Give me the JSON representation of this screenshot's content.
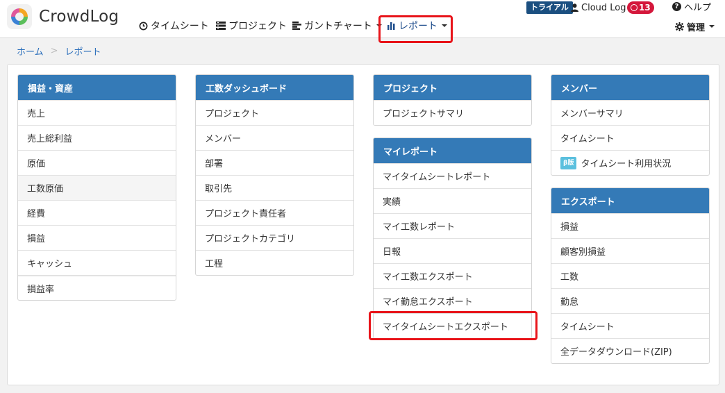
{
  "brand": {
    "name": "CrowdLog"
  },
  "nav": {
    "timesheet": "タイムシート",
    "project": "プロジェクト",
    "gantt": "ガントチャート",
    "report": "レポート"
  },
  "header_right": {
    "trial": "トライアル",
    "user": "Cloud Log",
    "badge_count": "13",
    "help": "ヘルプ",
    "admin": "管理"
  },
  "breadcrumb": {
    "home": "ホーム",
    "separator": ">",
    "current": "レポート"
  },
  "colors": {
    "panel_header": "#347ab7",
    "highlight": "#e8141a",
    "trial": "#1b4f80",
    "badge": "#d4173b",
    "beta": "#5bc0de"
  },
  "panels": {
    "profit": {
      "title": "損益・資産",
      "items": [
        "売上",
        "売上総利益",
        "原価",
        "工数原価",
        "経費",
        "損益",
        "キャッシュ",
        "損益率"
      ]
    },
    "dashboard": {
      "title": "工数ダッシュボード",
      "items": [
        "プロジェクト",
        "メンバー",
        "部署",
        "取引先",
        "プロジェクト責任者",
        "プロジェクトカテゴリ",
        "工程"
      ]
    },
    "project": {
      "title": "プロジェクト",
      "items": [
        "プロジェクトサマリ"
      ]
    },
    "myreport": {
      "title": "マイレポート",
      "items": [
        "マイタイムシートレポート",
        "実績",
        "マイ工数レポート",
        "日報",
        "マイ工数エクスポート",
        "マイ勤怠エクスポート",
        "マイタイムシートエクスポート"
      ]
    },
    "member": {
      "title": "メンバー",
      "items": [
        "メンバーサマリ",
        "タイムシート",
        "タイムシート利用状況"
      ],
      "beta_label": "β版"
    },
    "export": {
      "title": "エクスポート",
      "items": [
        "損益",
        "顧客別損益",
        "工数",
        "勤怠",
        "タイムシート",
        "全データダウンロード(ZIP)"
      ]
    }
  }
}
